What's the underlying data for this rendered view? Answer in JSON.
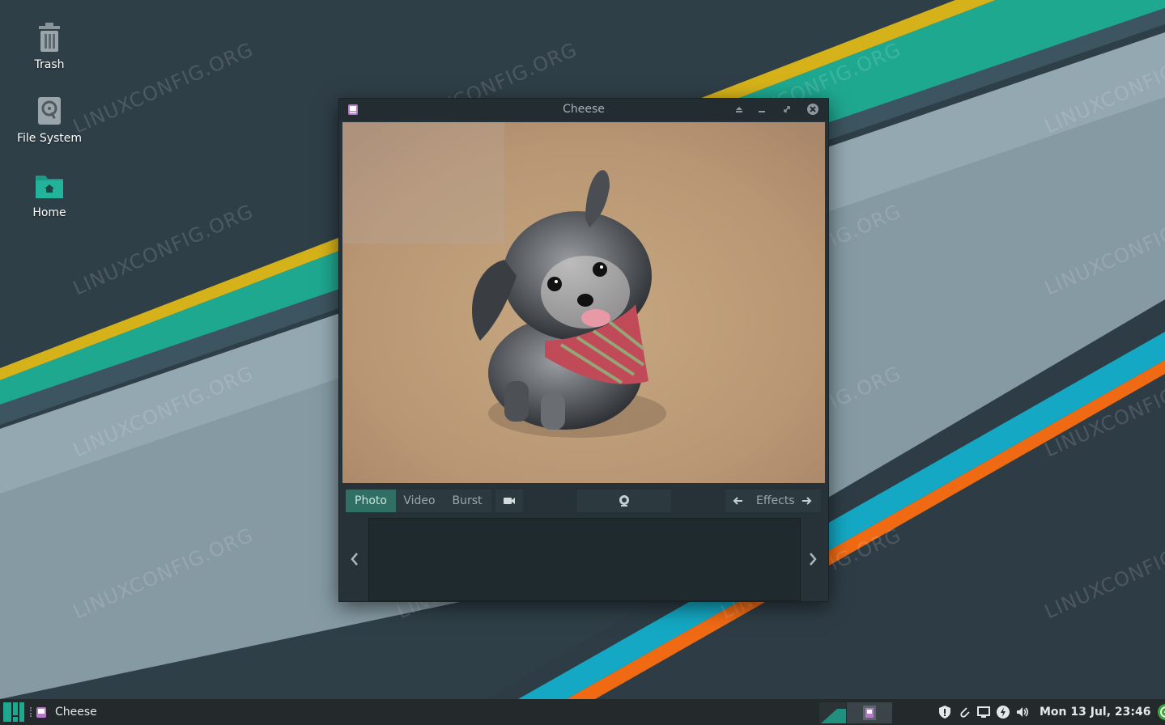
{
  "desktop": {
    "icons": [
      {
        "label": "Trash"
      },
      {
        "label": "File System"
      },
      {
        "label": "Home"
      }
    ],
    "watermark": "LINUXCONFIG.ORG"
  },
  "window": {
    "title": "Cheese",
    "modes": {
      "photo": "Photo",
      "video": "Video",
      "burst": "Burst"
    },
    "effects_label": "Effects"
  },
  "panel": {
    "task_label": "Cheese",
    "clock": "Mon 13 Jul, 23:46"
  },
  "colors": {
    "accent": "#2f6f64",
    "wallpaper_dark": "#2f3f48",
    "stripe_teal": "#1fa890",
    "stripe_yellow": "#d6b21a",
    "stripe_orange": "#f06a14",
    "stripe_cyan": "#14a8c4"
  }
}
